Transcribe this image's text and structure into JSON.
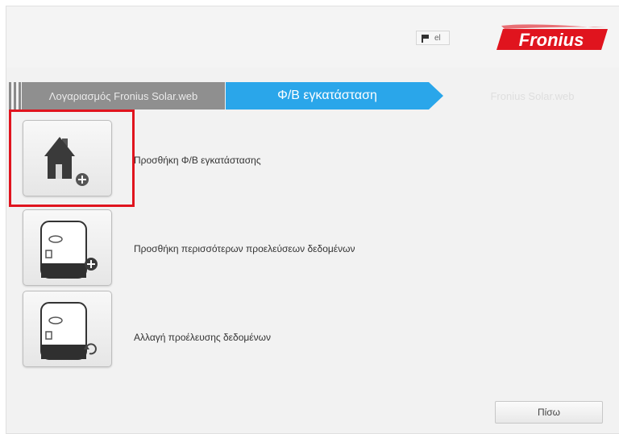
{
  "header": {
    "language": "el",
    "logo_text": "Fronius"
  },
  "steps": [
    {
      "label": "Λογαριασμός Fronius Solar.web",
      "state": "done"
    },
    {
      "label": "Φ/Β εγκατάσταση",
      "state": "active"
    },
    {
      "label": "Fronius Solar.web",
      "state": "pending"
    }
  ],
  "actions": [
    {
      "label": "Προσθήκη Φ/Β εγκατάστασης",
      "icon": "house-add-icon",
      "highlighted": true
    },
    {
      "label": "Προσθήκη περισσότερων προελεύσεων δεδομένων",
      "icon": "inverter-add-icon"
    },
    {
      "label": "Αλλαγή προέλευσης δεδομένων",
      "icon": "inverter-change-icon"
    }
  ],
  "footer": {
    "back_label": "Πίσω"
  },
  "colors": {
    "accent": "#2aa6ea",
    "brand_red": "#e0141e",
    "highlight": "#e0141e"
  }
}
